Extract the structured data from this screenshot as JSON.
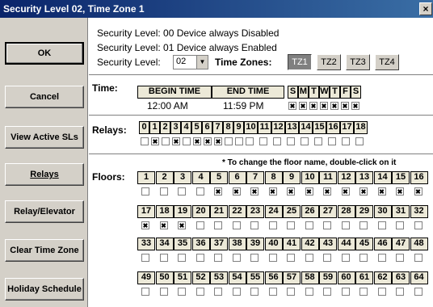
{
  "window": {
    "title": "Security Level 02, Time Zone 1",
    "close_glyph": "×"
  },
  "left_buttons": [
    {
      "label": "OK",
      "name": "ok-button"
    },
    {
      "label": "Cancel",
      "name": "cancel-button"
    },
    {
      "label": "View Active SLs",
      "name": "view-active-sls-button"
    },
    {
      "label": "Relays",
      "name": "relays-button"
    },
    {
      "label": "Relay/Elevator",
      "name": "relay-elevator-button"
    },
    {
      "label": "Clear Time Zone",
      "name": "clear-time-zone-button"
    },
    {
      "label": "Holiday Schedule",
      "name": "holiday-schedule-button"
    }
  ],
  "security": {
    "line1": "Security Level:  00 Device always Disabled",
    "line2": "Security Level:  01 Device always Enabled",
    "label": "Security Level:",
    "selected": "02",
    "time_zones_label": "Time Zones:",
    "time_zones": [
      "TZ1",
      "TZ2",
      "TZ3",
      "TZ4"
    ],
    "active_time_zone": "TZ1"
  },
  "time": {
    "label": "Time:",
    "begin_header": "BEGIN TIME",
    "end_header": "END TIME",
    "begin_value": "12:00 AM",
    "end_value": "11:59 PM",
    "days": [
      "S",
      "M",
      "T",
      "W",
      "T",
      "F",
      "S"
    ],
    "days_checked": [
      true,
      true,
      true,
      true,
      true,
      true,
      true
    ]
  },
  "relays": {
    "label": "Relays:",
    "numbers": [
      "0",
      "1",
      "2",
      "3",
      "4",
      "5",
      "6",
      "7",
      "8",
      "9",
      "10",
      "11",
      "12",
      "13",
      "14",
      "15",
      "16",
      "17",
      "18"
    ],
    "checked": [
      false,
      true,
      false,
      true,
      false,
      true,
      true,
      true,
      false,
      false,
      false,
      false,
      false,
      false,
      false,
      false,
      false,
      false,
      false
    ]
  },
  "floors": {
    "label": "Floors:",
    "note": "* To change the floor name, double-click on it",
    "rows": [
      {
        "numbers": [
          "1",
          "2",
          "3",
          "4",
          "5",
          "6",
          "7",
          "8",
          "9",
          "10",
          "11",
          "12",
          "13",
          "14",
          "15",
          "16"
        ],
        "checked": [
          false,
          false,
          false,
          false,
          true,
          true,
          true,
          true,
          true,
          true,
          true,
          true,
          true,
          true,
          true,
          true
        ]
      },
      {
        "numbers": [
          "17",
          "18",
          "19",
          "20",
          "21",
          "22",
          "23",
          "24",
          "25",
          "26",
          "27",
          "28",
          "29",
          "30",
          "31",
          "32"
        ],
        "checked": [
          true,
          true,
          true,
          false,
          false,
          false,
          false,
          false,
          false,
          false,
          false,
          false,
          false,
          false,
          false,
          false
        ]
      },
      {
        "numbers": [
          "33",
          "34",
          "35",
          "36",
          "37",
          "38",
          "39",
          "40",
          "41",
          "42",
          "43",
          "44",
          "45",
          "46",
          "47",
          "48"
        ],
        "checked": [
          false,
          false,
          false,
          false,
          false,
          false,
          false,
          false,
          false,
          false,
          false,
          false,
          false,
          false,
          false,
          false
        ]
      },
      {
        "numbers": [
          "49",
          "50",
          "51",
          "52",
          "53",
          "54",
          "55",
          "56",
          "57",
          "58",
          "59",
          "60",
          "61",
          "62",
          "63",
          "64"
        ],
        "checked": [
          false,
          false,
          false,
          false,
          false,
          false,
          false,
          false,
          false,
          false,
          false,
          false,
          false,
          false,
          false,
          false
        ]
      }
    ]
  }
}
